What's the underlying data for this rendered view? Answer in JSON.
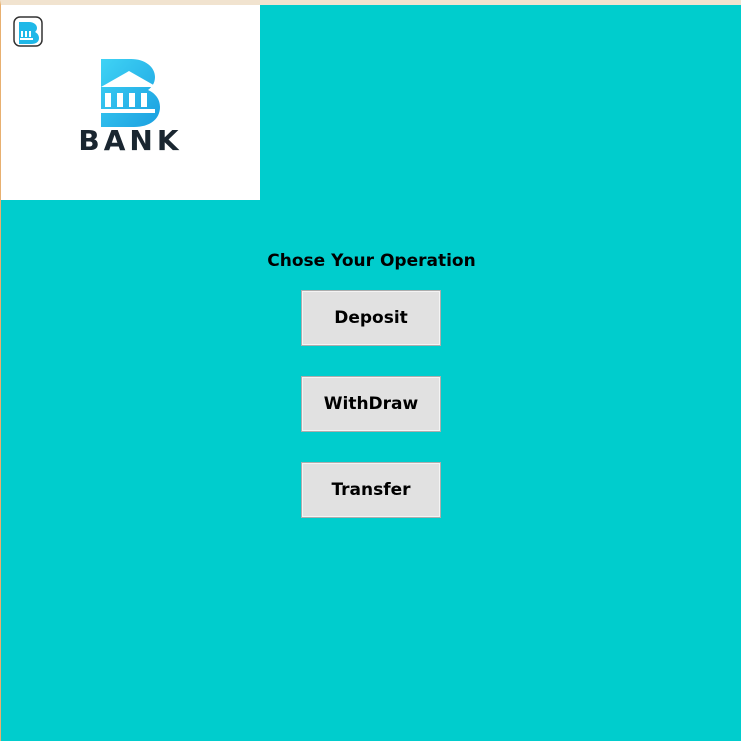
{
  "window": {
    "background": "#00cdcd",
    "app_icon": "bank-app-icon"
  },
  "logo": {
    "icon": "bank-building-icon",
    "text": "BANK",
    "accent": "#1fb8e8",
    "text_color": "#1a2630"
  },
  "main": {
    "prompt": "Chose Your Operation",
    "buttons": [
      {
        "label": "Deposit"
      },
      {
        "label": "WithDraw"
      },
      {
        "label": "Transfer"
      }
    ]
  }
}
